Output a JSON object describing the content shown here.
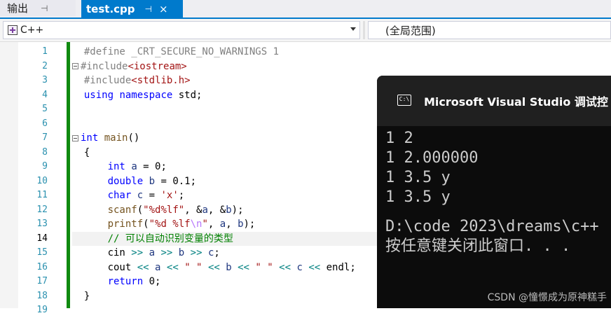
{
  "tabs": [
    {
      "label": "输出",
      "active": false,
      "pin": "pin-icon"
    },
    {
      "label": "test.cpp",
      "active": true,
      "pin": "pin-icon",
      "close": "×"
    }
  ],
  "navbar": {
    "scope": "C++",
    "member": "(全局范围)"
  },
  "editor": {
    "line_numbers": [
      "1",
      "2",
      "3",
      "4",
      "5",
      "6",
      "7",
      "8",
      "9",
      "10",
      "11",
      "12",
      "13",
      "14",
      "15",
      "16",
      "17",
      "18",
      "19"
    ],
    "current_line": "14",
    "lines": [
      "#define _CRT_SECURE_NO_WARNINGS 1",
      "#include<iostream>",
      "#include<stdlib.h>",
      "using namespace std;",
      "",
      "",
      "int main()",
      "{",
      "int a = 0;",
      "double b = 0.1;",
      "char c = 'x';",
      "scanf(\"%d%lf\", &a, &b);",
      "printf(\"%d %lf\\n\", a, b);",
      "// 可以自动识别变量的类型",
      "cin >> a >> b >> c;",
      "cout << a << \" \" << b << \" \" << c << endl;",
      "return 0;",
      "}",
      ""
    ]
  },
  "console": {
    "title": "Microsoft Visual Studio 调试控",
    "icon": "console-icon",
    "output": [
      "1 2",
      "1 2.000000",
      "1 3.5 y",
      "1 3.5 y",
      "",
      "D:\\code 2023\\dreams\\c++",
      "按任意键关闭此窗口. . ."
    ]
  },
  "watermark": "CSDN @憧憬成为原神糕手",
  "colors": {
    "accent": "#007acc",
    "change_bar": "#108a10",
    "keyword": "#0000ff",
    "string": "#a31515",
    "comment": "#008000",
    "line_number": "#2b91af",
    "console_bg": "#0c0c0c"
  }
}
